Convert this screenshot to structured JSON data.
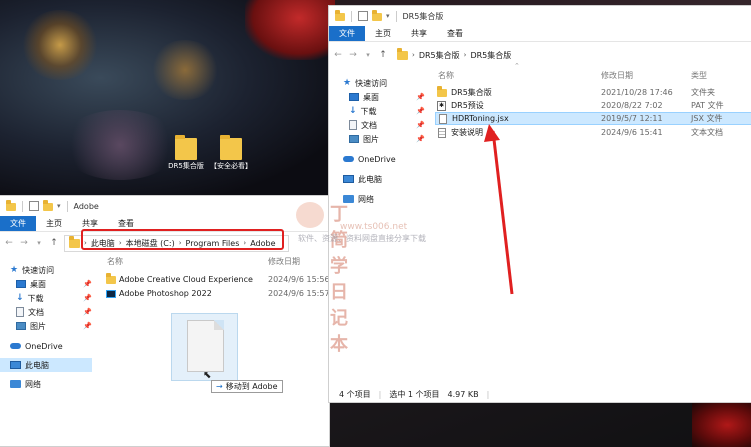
{
  "desktop": {
    "icons": [
      {
        "label": "DR5集合版"
      },
      {
        "label": "【安全必看】"
      }
    ]
  },
  "left_window": {
    "title": "Adobe",
    "ribbon_tabs": [
      "文件",
      "主页",
      "共享",
      "查看"
    ],
    "breadcrumb": [
      "此电脑",
      "本地磁盘 (C:)",
      "Program Files",
      "Adobe"
    ],
    "nav": {
      "quick_access": "快速访问",
      "items": [
        "桌面",
        "下载",
        "文档",
        "图片"
      ],
      "onedrive": "OneDrive",
      "this_pc": "此电脑",
      "network": "网络"
    },
    "columns": {
      "name": "名称",
      "date": "修改日期"
    },
    "files": [
      {
        "name": "Adobe Creative Cloud Experience",
        "date": "2024/9/6 15:56"
      },
      {
        "name": "Adobe Photoshop 2022",
        "date": "2024/9/6 15:57"
      }
    ],
    "drag_tooltip": {
      "arrow": "→",
      "text": "移动到 Adobe"
    }
  },
  "right_window": {
    "title": "DR5集合版",
    "ribbon_tabs": [
      "文件",
      "主页",
      "共享",
      "查看"
    ],
    "breadcrumb": [
      "DR5集合版",
      "DR5集合版"
    ],
    "nav": {
      "quick_access": "快速访问",
      "items": [
        "桌面",
        "下载",
        "文档",
        "图片"
      ],
      "onedrive": "OneDrive",
      "this_pc": "此电脑",
      "network": "网络"
    },
    "columns": {
      "name": "名称",
      "date": "修改日期",
      "type": "类型"
    },
    "files": [
      {
        "name": "DR5集合版",
        "date": "2021/10/28 17:46",
        "type": "文件夹",
        "icon": "folder"
      },
      {
        "name": "DR5预设",
        "date": "2020/8/22 7:02",
        "type": "PAT 文件",
        "icon": "pat"
      },
      {
        "name": "HDRToning.jsx",
        "date": "2019/5/7 12:11",
        "type": "JSX 文件",
        "icon": "doc",
        "selected": true
      },
      {
        "name": "安装说明",
        "date": "2024/9/6 15:41",
        "type": "文本文档",
        "icon": "txt"
      }
    ],
    "status": {
      "count": "4 个项目",
      "selected": "选中 1 个项目",
      "size": "4.97 KB"
    }
  },
  "watermark": {
    "title": "丁简学日记本",
    "url": "www.ts006.net",
    "subtitle": "软件、资源、资料网盘直接分享下载"
  },
  "colors": {
    "accent": "#1a6fc9",
    "highlight": "#e02020",
    "selection": "#cce8ff"
  }
}
